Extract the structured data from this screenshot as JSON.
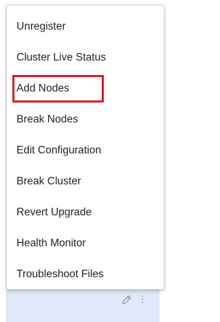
{
  "menu": {
    "items": [
      {
        "label": "Unregister"
      },
      {
        "label": "Cluster Live Status"
      },
      {
        "label": "Add Nodes"
      },
      {
        "label": "Break Nodes"
      },
      {
        "label": "Edit Configuration"
      },
      {
        "label": "Break Cluster"
      },
      {
        "label": "Revert Upgrade"
      },
      {
        "label": "Health Monitor"
      },
      {
        "label": "Troubleshoot Files"
      }
    ]
  },
  "card": {
    "edit_icon": "pencil-icon",
    "more_icon": "kebab-icon",
    "more_glyph": "⋮"
  },
  "colors": {
    "highlight": "#e0161e",
    "card_background": "#dfe9f9",
    "text": "#1d2125"
  }
}
